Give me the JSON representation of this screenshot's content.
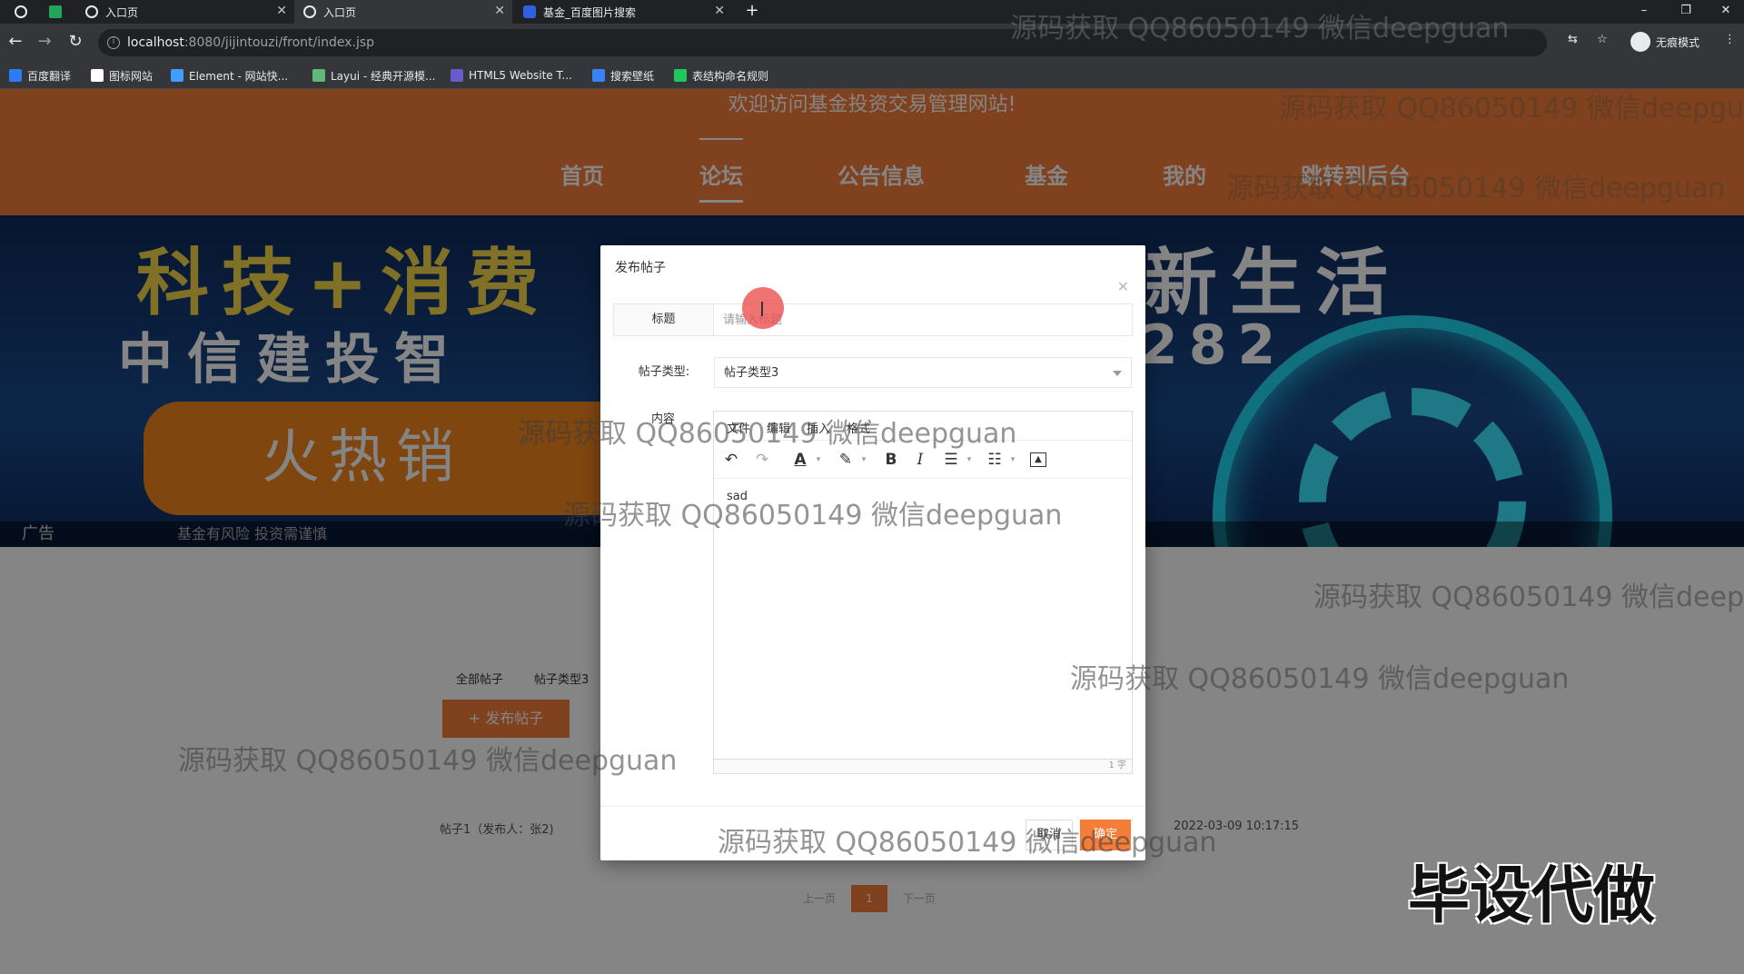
{
  "browser": {
    "tabs": [
      {
        "label": "",
        "type": "pinned"
      },
      {
        "label": "",
        "type": "pinned-sheet"
      },
      {
        "label": "入口页"
      },
      {
        "label": "入口页",
        "active": true
      },
      {
        "label": "基金_百度图片搜索"
      }
    ],
    "close_glyph": "✕",
    "new_tab_glyph": "+",
    "window_controls": [
      "–",
      "❐",
      "✕"
    ],
    "url_host": "localhost",
    "url_rest": ":8080/jijintouzi/front/index.jsp",
    "incognito_label": "无痕模式",
    "bookmarks": [
      {
        "label": "百度翻译",
        "color": "#2d7cf6"
      },
      {
        "label": "图标网站",
        "color": "#ffffff"
      },
      {
        "label": "Element - 网站快...",
        "color": "#409eff"
      },
      {
        "label": "Layui - 经典开源模...",
        "color": "#5fb878"
      },
      {
        "label": "HTML5 Website T...",
        "color": "#6a5acd"
      },
      {
        "label": "搜索壁纸",
        "color": "#3b82f6"
      },
      {
        "label": "表结构命名规则",
        "color": "#22c55e"
      }
    ]
  },
  "site": {
    "welcome": "欢迎访问基金投资交易管理网站!",
    "nav": [
      "首页",
      "论坛",
      "公告信息",
      "基金",
      "我的",
      "跳转到后台"
    ],
    "active_nav": "论坛",
    "accent": "#f57d3a",
    "banner": {
      "line1": "科技+消费",
      "line1_right": "新生活",
      "line2": "中信建投智",
      "line2_right": "282",
      "button": "火热销",
      "ad_tag": "广告",
      "ad_text": "基金有风险 投资需谨慎"
    },
    "filters": [
      "全部帖子",
      "帖子类型3"
    ],
    "publish_button": "+ 发布帖子",
    "post": {
      "title": "帖子1（发布人：张2)",
      "time": "2022-03-09 10:17:15"
    },
    "pager": {
      "prev": "上一页",
      "current": "1",
      "next": "下一页"
    }
  },
  "modal": {
    "title": "发布帖子",
    "title_label": "标题",
    "title_placeholder": "请输入标题",
    "type_label": "帖子类型:",
    "type_value": "帖子类型3",
    "content_label": "内容",
    "editor_tabs": [
      "文件",
      "编辑",
      "插入",
      "格式"
    ],
    "toolbar": [
      "undo-icon",
      "redo-icon",
      "font-color-icon",
      "highlight-icon",
      "bold-icon",
      "italic-icon",
      "bullet-list-icon",
      "numbered-list-icon",
      "image-icon"
    ],
    "editor_text": "sad",
    "char_count": "1 字",
    "cancel": "取消",
    "confirm": "确定"
  },
  "watermarks": [
    "源码获取 QQ86050149 微信deepguan",
    "毕设代做"
  ]
}
